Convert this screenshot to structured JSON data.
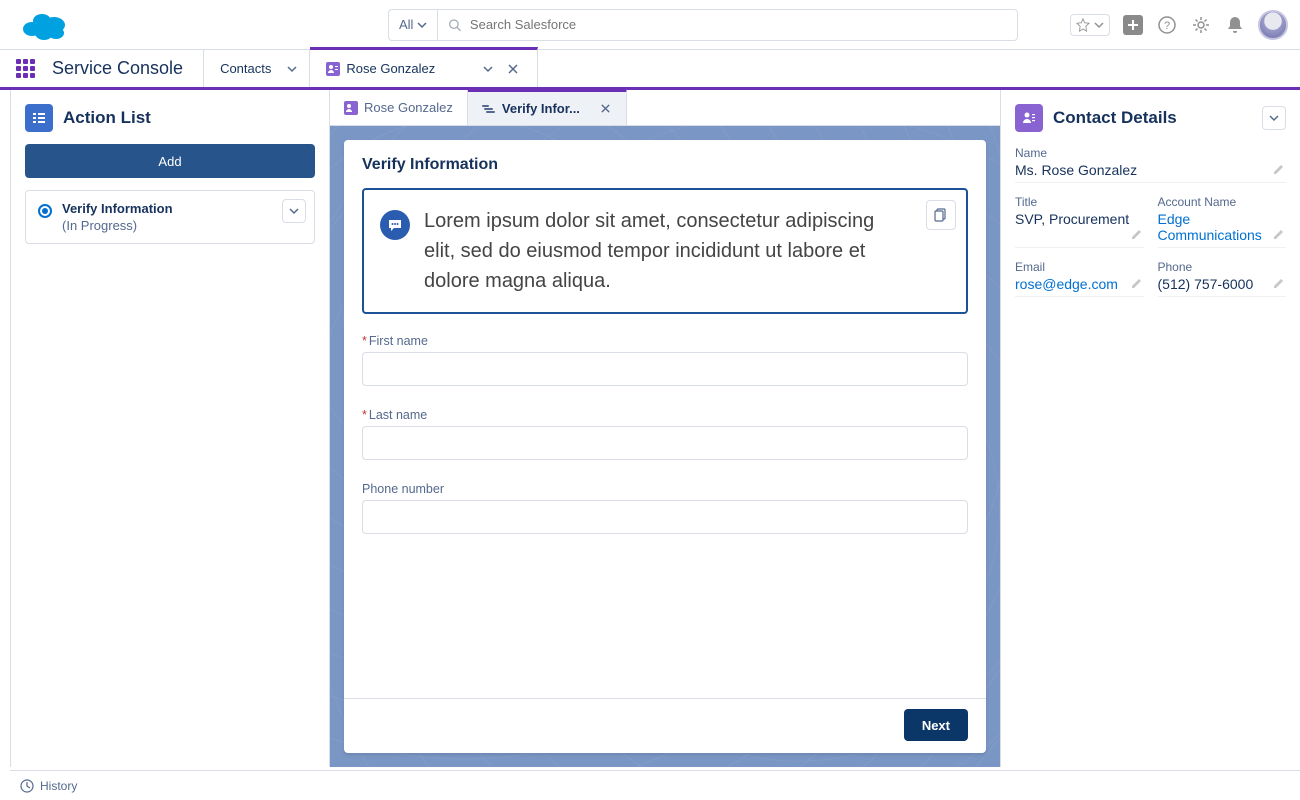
{
  "header": {
    "scope_label": "All",
    "search_placeholder": "Search Salesforce"
  },
  "nav": {
    "app_name": "Service Console",
    "tabs": [
      {
        "label": "Contacts"
      },
      {
        "label": "Rose Gonzalez",
        "active": true
      }
    ]
  },
  "subtabs": [
    {
      "label": "Rose Gonzalez",
      "active": false
    },
    {
      "label": "Verify Infor...",
      "active": true
    }
  ],
  "action_list": {
    "title": "Action List",
    "add_label": "Add",
    "items": [
      {
        "title": "Verify Information",
        "status": "(In Progress)"
      }
    ]
  },
  "verify": {
    "heading": "Verify Information",
    "message": "Lorem ipsum dolor sit amet, consectetur adipiscing elit, sed do eiusmod tempor incididunt ut labore et dolore magna aliqua.",
    "fields": {
      "first_name_label": "First name",
      "last_name_label": "Last name",
      "phone_label": "Phone number"
    },
    "next_label": "Next"
  },
  "details": {
    "title": "Contact Details",
    "name_label": "Name",
    "name_value": "Ms. Rose Gonzalez",
    "title_label": "Title",
    "title_value": "SVP, Procurement",
    "account_label": "Account Name",
    "account_value": "Edge Communications",
    "email_label": "Email",
    "email_value": "rose@edge.com",
    "phone_label": "Phone",
    "phone_value": "(512) 757-6000"
  },
  "footer": {
    "history_label": "History"
  }
}
